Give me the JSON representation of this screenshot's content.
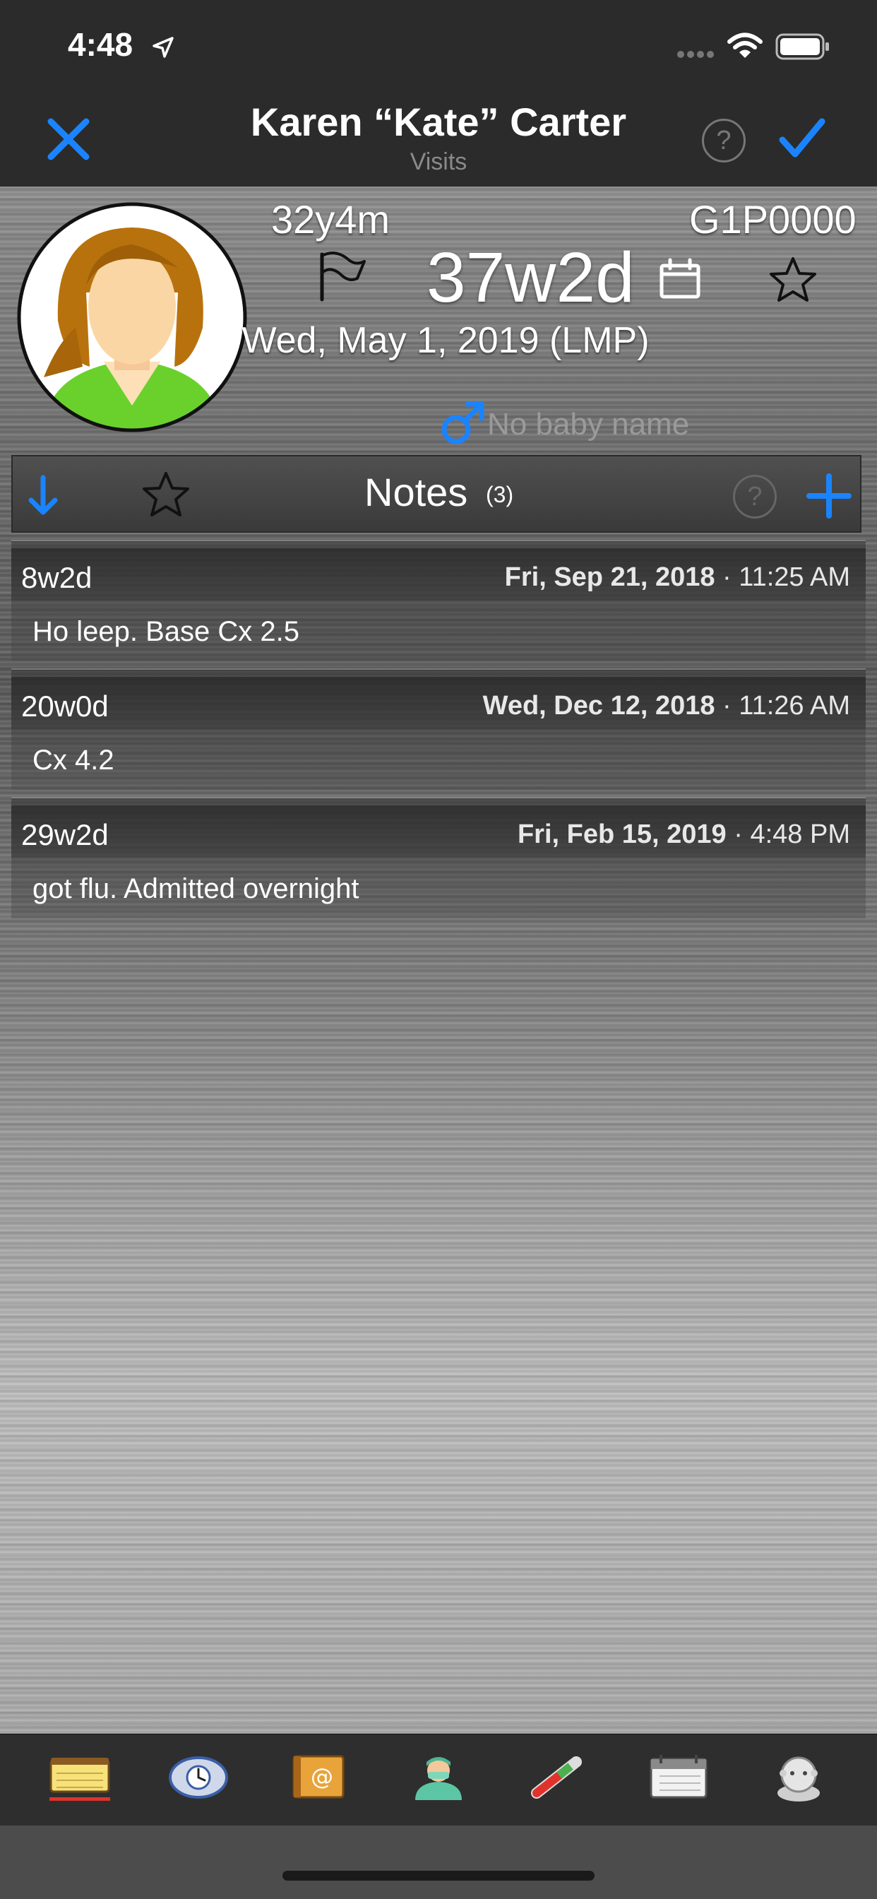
{
  "status": {
    "time": "4:48"
  },
  "nav": {
    "title": "Karen “Kate” Carter",
    "subtitle": "Visits",
    "help": "?"
  },
  "patient": {
    "age": "32y4m",
    "gravida_para": "G1P0000",
    "gestational_age": "37w2d",
    "lmp_date": "Wed, May 1, 2019 (LMP)",
    "baby_name": "No baby name"
  },
  "notes": {
    "title": "Notes",
    "count": "(3)",
    "help": "?",
    "items": [
      {
        "ga": "8w2d",
        "date": "Fri, Sep 21, 2018",
        "sep": "·",
        "time": "11:25 AM",
        "text": "Ho leep. Base Cx 2.5"
      },
      {
        "ga": "20w0d",
        "date": "Wed, Dec 12, 2018",
        "sep": "·",
        "time": "11:26 AM",
        "text": "Cx 4.2"
      },
      {
        "ga": "29w2d",
        "date": "Fri, Feb 15, 2019",
        "sep": "·",
        "time": "4:48 PM",
        "text": "got flu.  Admitted overnight"
      }
    ]
  },
  "colors": {
    "accent": "#1a84ff",
    "active_tab_underline": "#e0322b"
  },
  "tabs": [
    {
      "icon": "notepad-icon",
      "active": true
    },
    {
      "icon": "clock-globe-icon",
      "active": false
    },
    {
      "icon": "address-book-icon",
      "active": false
    },
    {
      "icon": "doctor-icon",
      "active": false
    },
    {
      "icon": "test-tube-icon",
      "active": false
    },
    {
      "icon": "calendar-icon",
      "active": false
    },
    {
      "icon": "baby-icon",
      "active": false
    }
  ]
}
